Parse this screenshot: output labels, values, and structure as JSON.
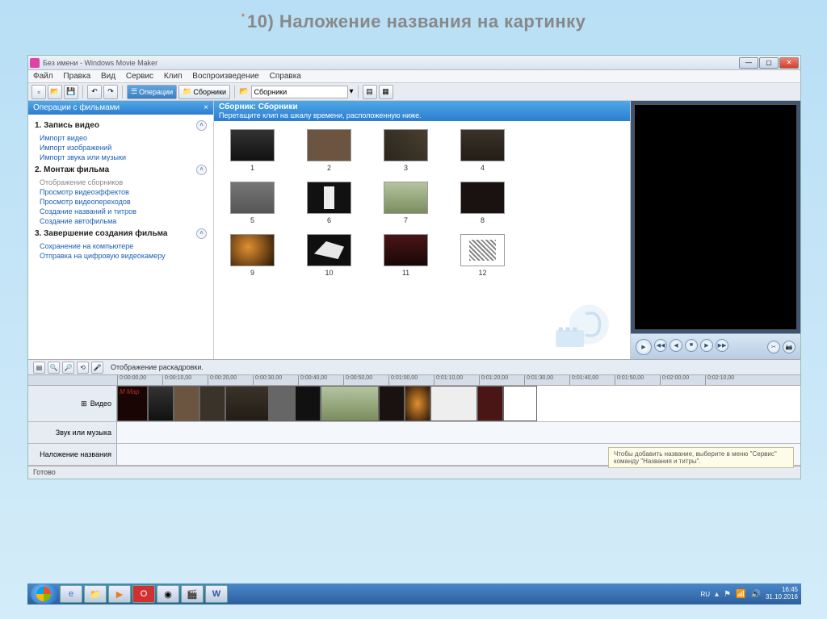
{
  "slide": {
    "bullet": "*",
    "title": "10) Наложение названия на картинку"
  },
  "window": {
    "title": "Без имени - Windows Movie Maker",
    "controls": {
      "min": "—",
      "max": "▢",
      "close": "✕"
    }
  },
  "menu": {
    "file": "Файл",
    "edit": "Правка",
    "view": "Вид",
    "tools": "Сервис",
    "clip": "Клип",
    "play": "Воспроизведение",
    "help": "Справка"
  },
  "toolbar": {
    "new": "▫",
    "open": "📂",
    "save": "💾",
    "undo": "↶",
    "redo": "↷",
    "tasks_label": "Операции",
    "collections_label": "Сборники",
    "location": "Сборники",
    "search": "🔍"
  },
  "sidebar": {
    "header": "Операции с фильмами",
    "s1": {
      "title": "1. Запись видео",
      "links": [
        "Импорт видео",
        "Импорт изображений",
        "Импорт звука или музыки"
      ]
    },
    "s2": {
      "title": "2. Монтаж фильма",
      "links": [
        "Отображение сборников",
        "Просмотр видеоэффектов",
        "Просмотр видеопереходов",
        "Создание названий и титров",
        "Создание автофильма"
      ]
    },
    "s3": {
      "title": "3. Завершение создания фильма",
      "links": [
        "Сохранение на компьютере",
        "Отправка на цифровую видеокамеру"
      ]
    }
  },
  "content": {
    "header_title": "Сборник: Сборники",
    "header_sub": "Перетащите клип на шкалу времени, расположенную ниже.",
    "thumbs": [
      "1",
      "2",
      "3",
      "4",
      "5",
      "6",
      "7",
      "8",
      "9",
      "10",
      "11",
      "12"
    ]
  },
  "preview": {
    "play": "▶",
    "prev": "◀◀",
    "back": "◀",
    "stop": "■",
    "fwd": "▶",
    "next": "▶▶",
    "split": "✂",
    "photo": "📷"
  },
  "timeline": {
    "toolbar_label": "Отображение раскадровки.",
    "ticks": [
      "0:00:00,00",
      "0:00:10,00",
      "0:00:20,00",
      "0:00:30,00",
      "0:00:40,00",
      "0:00:50,00",
      "0:01:00,00",
      "0:01:10,00",
      "0:01:20,00",
      "0:01:30,00",
      "0:01:40,00",
      "0:01:50,00",
      "0:02:00,00",
      "0:02:10,00"
    ],
    "track_video": "Видео",
    "track_audio": "Звук или музыка",
    "track_title": "Наложение названия",
    "title_clip": "М Мар",
    "hint": "Чтобы добавить название, выберите в меню \"Сервис\" команду \"Названия и титры\"."
  },
  "statusbar": {
    "text": "Готово"
  },
  "taskbar": {
    "lang": "RU",
    "time": "16:45",
    "date": "31.10.2016"
  }
}
